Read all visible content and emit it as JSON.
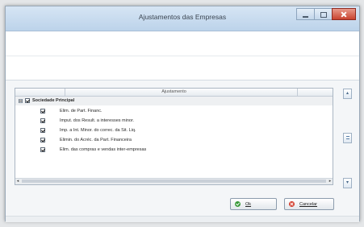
{
  "window": {
    "title": "Ajustamentos das Empresas"
  },
  "grid": {
    "column_header": "Ajustamento",
    "group_label": "Sociedade Principal",
    "rows": [
      {
        "label": "Elim. de Part. Financ.",
        "checked": true
      },
      {
        "label": "Imput. dos Result. a interesses minor.",
        "checked": true
      },
      {
        "label": "Imp. a Int. Minor. do correc. da Sit. Liq.",
        "checked": true
      },
      {
        "label": "Elimin. do Acréc. da Part. Financeira",
        "checked": true
      },
      {
        "label": "Elim. das compras e vendas inter-empresas",
        "checked": true
      }
    ],
    "scroll_left_arrow": "◂",
    "scroll_right_arrow": "▸"
  },
  "buttons": {
    "ok_label": "Ok",
    "cancel_label": "Cancelar"
  },
  "side_buttons": {
    "up_arrow": "▴",
    "down_arrow": "▾"
  }
}
